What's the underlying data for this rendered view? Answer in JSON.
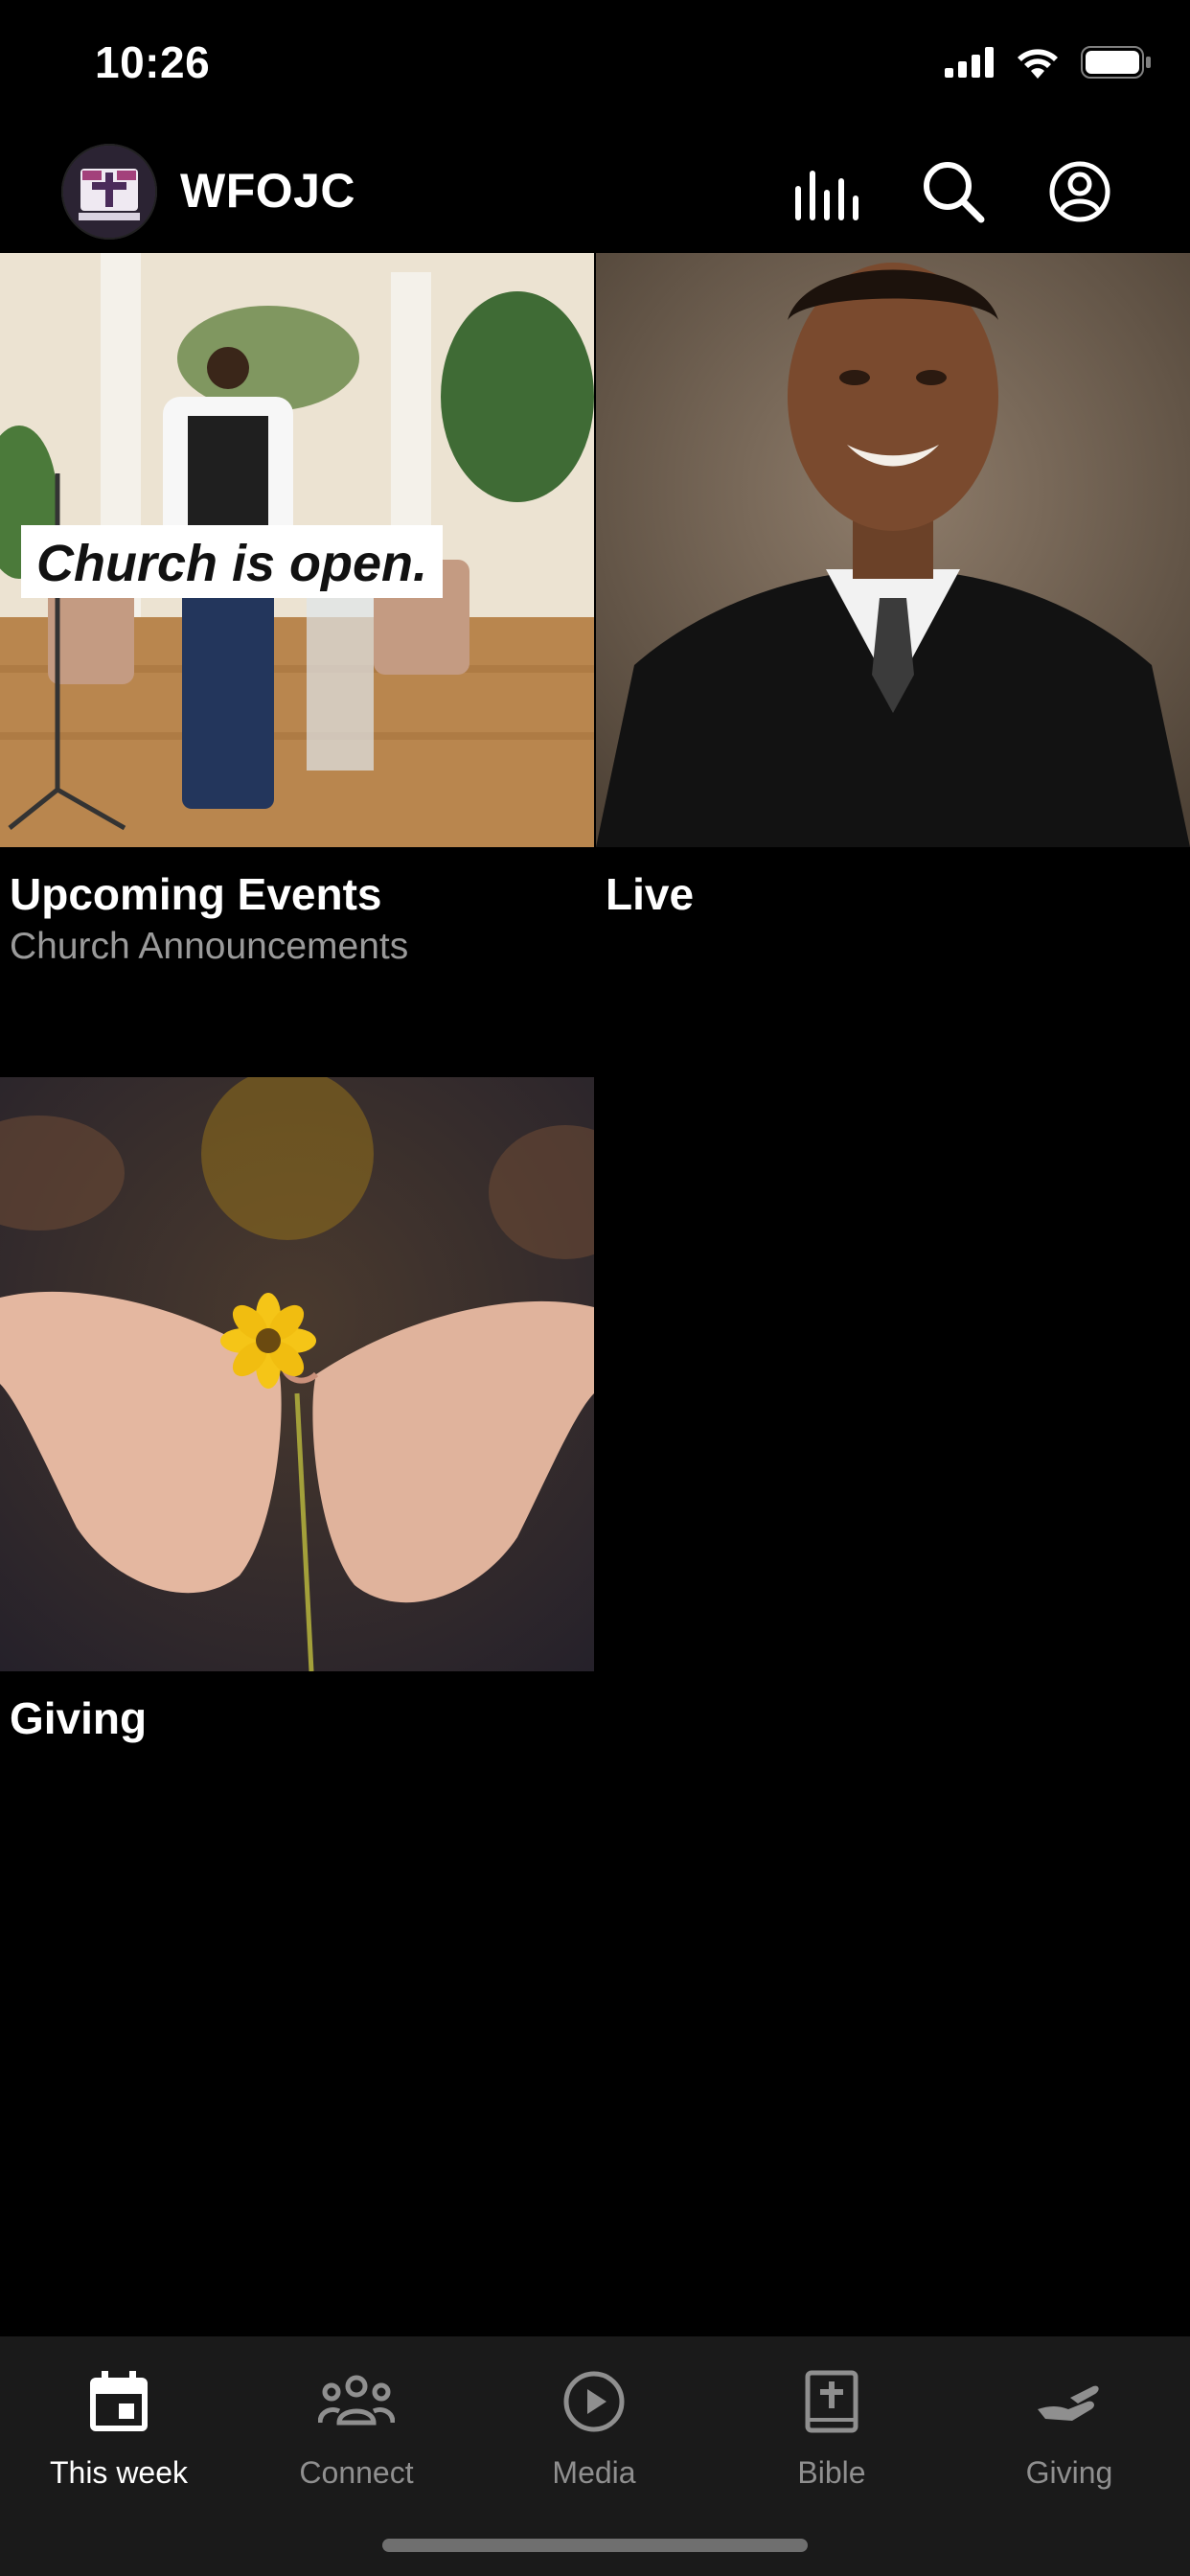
{
  "status_bar": {
    "time": "10:26"
  },
  "header": {
    "title": "WFOJC"
  },
  "tiles": [
    {
      "title": "Upcoming Events",
      "subtitle": "Church Announcements",
      "image_text": "Church is open."
    },
    {
      "title": "Live",
      "subtitle": ""
    },
    {
      "title": "Giving",
      "subtitle": ""
    }
  ],
  "tabs": [
    {
      "label": "This week",
      "icon": "calendar-icon",
      "active": true
    },
    {
      "label": "Connect",
      "icon": "people-icon",
      "active": false
    },
    {
      "label": "Media",
      "icon": "play-circle-icon",
      "active": false
    },
    {
      "label": "Bible",
      "icon": "bible-icon",
      "active": false
    },
    {
      "label": "Giving",
      "icon": "giving-hand-icon",
      "active": false
    }
  ],
  "colors": {
    "background": "#000000",
    "tabbar": "#1a1a1a",
    "active": "#ffffff",
    "inactive": "#8f8f8f"
  }
}
